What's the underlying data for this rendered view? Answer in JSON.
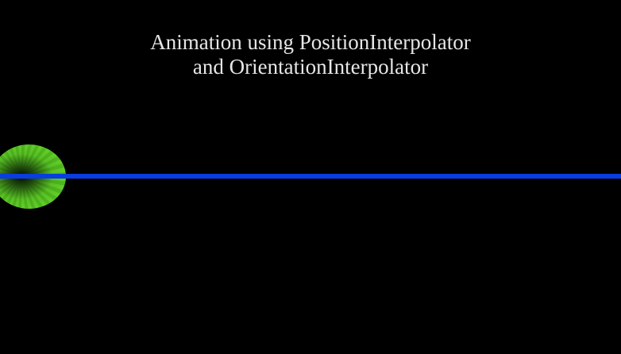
{
  "title": {
    "line1": "Animation using PositionInterpolator",
    "line2": "and OrientationInterpolator"
  },
  "colors": {
    "background": "#000000",
    "title_text": "#e6e6e6",
    "rail": "#0a3de0",
    "ball": "#56c022"
  }
}
